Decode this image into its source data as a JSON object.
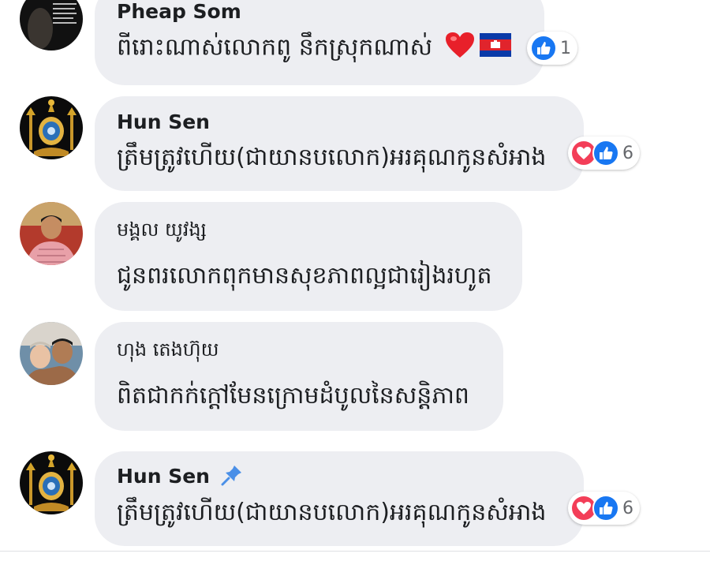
{
  "comments": [
    {
      "author": "Pheap Som",
      "text": "ពីរោះណាស់លោកពូ  នឹកស្រុកណាស់",
      "reaction_count": "1"
    },
    {
      "author": "Hun Sen",
      "text": "ត្រឹមត្រូវហើយ(ជាយានបលោក)អរគុណកូនសំអាង",
      "reaction_count": "6"
    },
    {
      "author": "មង្គល យូវង្ស",
      "text": "ជូនពរលោកពុកមានសុខភាពល្អជារៀងរហូត"
    },
    {
      "author": "ហុង តេងហ៊ុយ",
      "text": "ពិតជាកក់ក្ដៅមែនក្រោមដំបូលនៃសន្តិភាព"
    },
    {
      "author": "Hun Sen",
      "text": "ត្រឹមត្រូវហើយ(ជាយានបលោក)អរគុណកូនសំអាង",
      "reaction_count": "6"
    }
  ],
  "colors": {
    "bubble": "#edeef2",
    "like": "#1877f2",
    "love": "#f33e58",
    "pin": "#4a8fe7"
  },
  "icons": [
    "like-icon",
    "love-icon",
    "heart-emoji-icon",
    "cambodia-flag-icon",
    "pin-icon"
  ]
}
